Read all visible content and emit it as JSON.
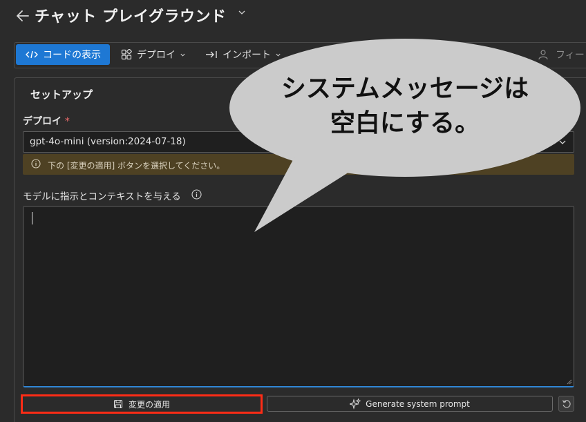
{
  "header": {
    "title": "チャット プレイグラウンド"
  },
  "toolbar": {
    "view_code_label": "コードの表示",
    "deploy_label": "デプロイ",
    "import_label": "インポート",
    "feedback_label": "フィー"
  },
  "setup": {
    "title": "セットアップ",
    "deploy_label": "デプロイ",
    "required_mark": "*",
    "deployment_value": "gpt-4o-mini (version:2024-07-18)",
    "warning_text": "下の [変更の適用] ボタンを選択してください。",
    "instructions_label": "モデルに指示とコンテキストを与える",
    "instructions_value": ""
  },
  "actions": {
    "apply_label": "変更の適用",
    "generate_label": "Generate system prompt"
  },
  "callout": {
    "line1": "システムメッセージは",
    "line2": "空白にする。"
  },
  "colors": {
    "primary": "#1e78d4",
    "highlight_border": "#ff2c16",
    "warning_bg": "#4e4123",
    "background": "#2b2b2b"
  },
  "icons": [
    "back-arrow-icon",
    "chevron-down-icon",
    "code-icon",
    "deploy-icon",
    "import-icon",
    "feedback-icon",
    "info-icon",
    "save-icon",
    "sparkle-icon",
    "reset-icon"
  ]
}
